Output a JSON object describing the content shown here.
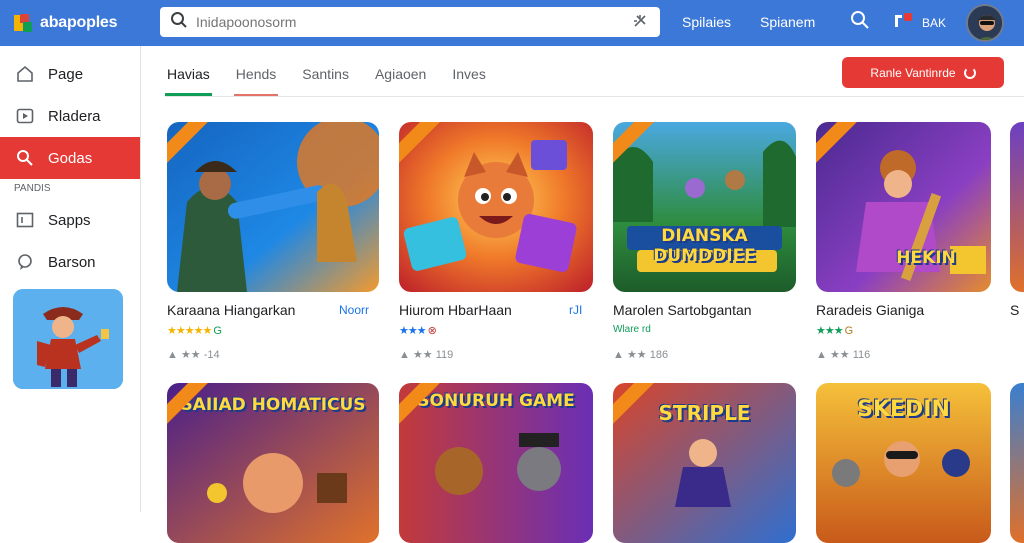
{
  "app": {
    "name": "abapoples"
  },
  "search": {
    "placeholder": "Inidapoonosorm"
  },
  "header": {
    "links": [
      "Spilaies",
      "Spianem"
    ],
    "badge": "BAK"
  },
  "sidebar": {
    "items": [
      {
        "label": "Page",
        "icon": "home-icon"
      },
      {
        "label": "Rladera",
        "icon": "play-icon"
      },
      {
        "label": "Godas",
        "icon": "search-icon",
        "active": true
      }
    ],
    "section": "PANDIS",
    "items2": [
      {
        "label": "Sapps",
        "icon": "apps-icon"
      },
      {
        "label": "Barson",
        "icon": "chat-icon"
      }
    ]
  },
  "tabs": [
    "Havias",
    "Hends",
    "Santins",
    "Agiaoen",
    "Inves"
  ],
  "cta": {
    "label": "Ranle Vantinrde"
  },
  "cards": [
    {
      "title": "Karaana Hiangarkan",
      "badge": "Noorr",
      "rating": "★★★★★",
      "rating_extra": "G",
      "meta": "-14",
      "colors": [
        "#1e6fc9",
        "#f2a33a"
      ]
    },
    {
      "title": "Hiurom HbarHaan",
      "badge": "rJI",
      "rating": "★★★",
      "rating_extra": "⊗",
      "meta": "119",
      "colors": [
        "#e8453c",
        "#f7c23a"
      ]
    },
    {
      "title": "Marolen Sartobgantan",
      "badge": "",
      "rating": "Wlare",
      "rating_extra": "rd",
      "meta": "186",
      "colors": [
        "#1a8a3a",
        "#3f9ad8"
      ]
    },
    {
      "title": "Raradeis Gianiga",
      "badge": "",
      "rating": "★★★",
      "rating_extra": "G",
      "meta": "116",
      "colors": [
        "#6a3fb5",
        "#e08a2a"
      ]
    }
  ],
  "row2": [
    {
      "title": "SAIIAD HOMATICUS",
      "colors": [
        "#6a2fb0",
        "#f08a20"
      ]
    },
    {
      "title": "SONURUH GAME",
      "colors": [
        "#c23a3a",
        "#7a2fb5"
      ]
    },
    {
      "title": "STRIPLE",
      "colors": [
        "#d8452a",
        "#2f6fd0"
      ]
    },
    {
      "title": "SKEDIN",
      "colors": [
        "#e0751e",
        "#f5c03a"
      ]
    }
  ],
  "peek": {
    "title": "S"
  }
}
